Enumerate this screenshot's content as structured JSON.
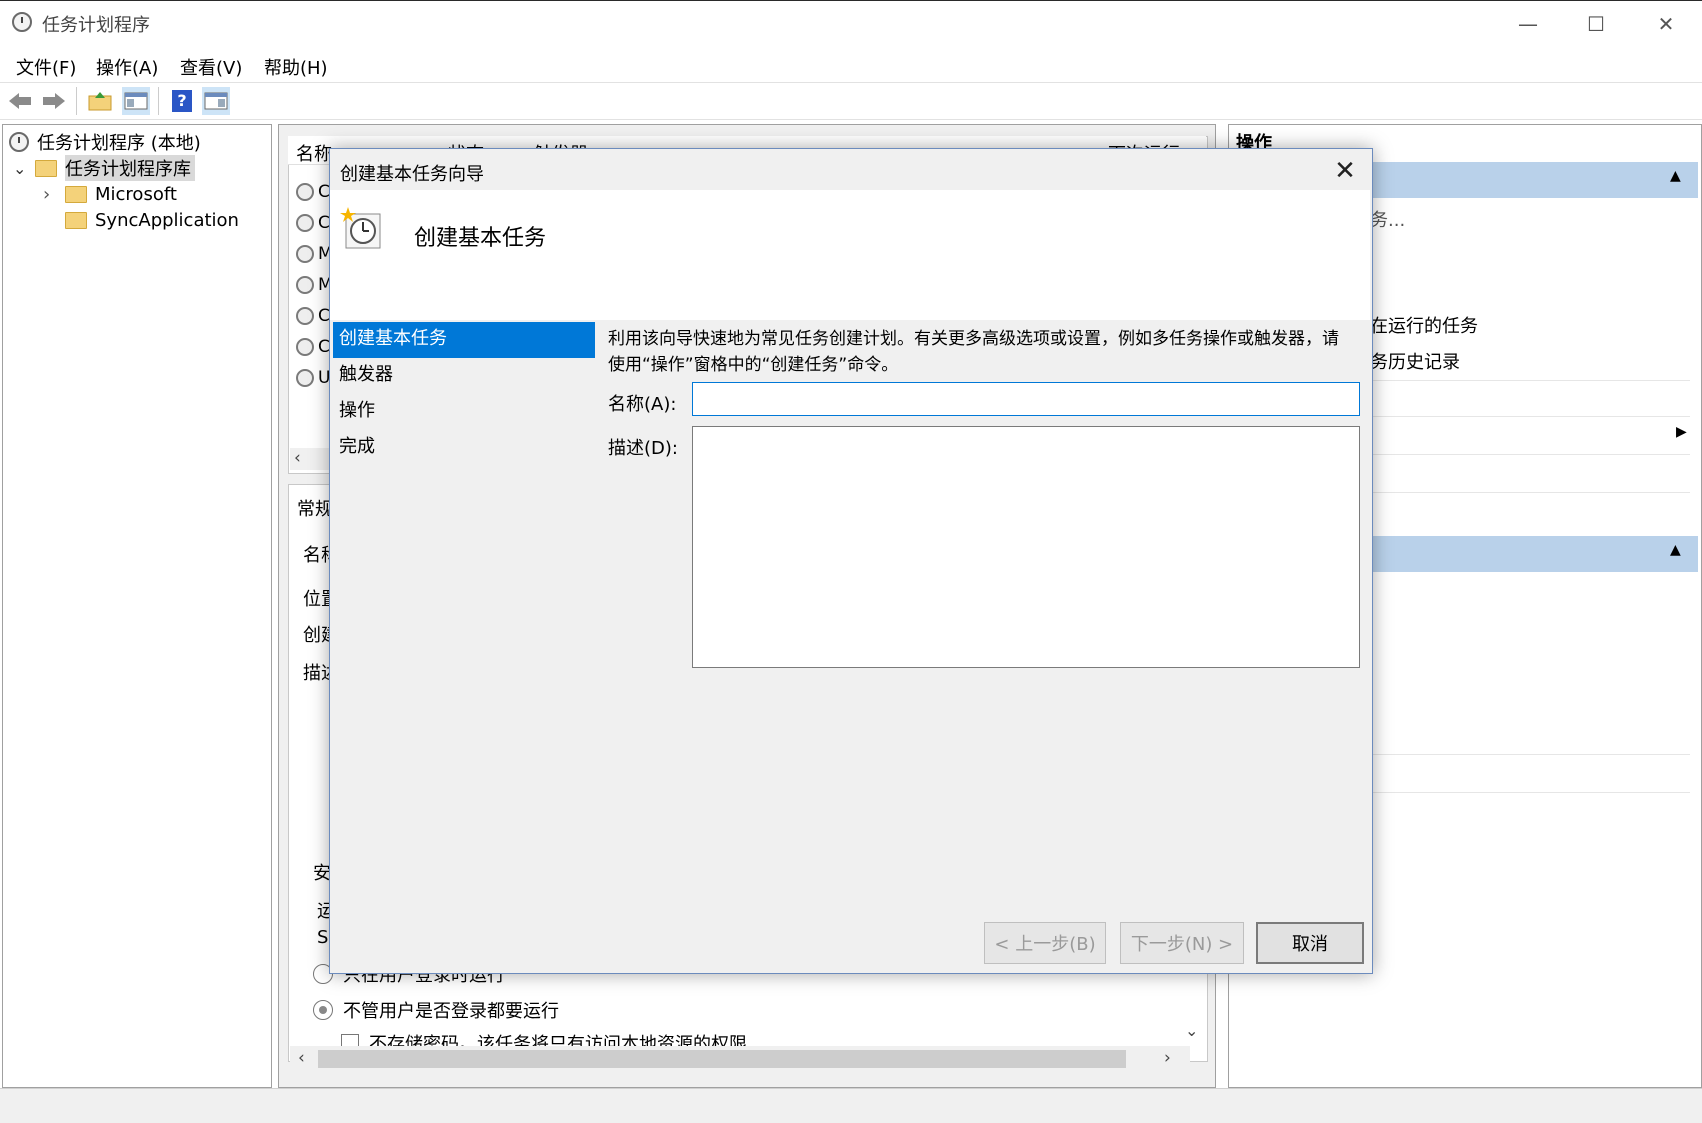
{
  "window": {
    "title": "任务计划程序",
    "min_glyph": "—",
    "max_glyph": "☐",
    "close_glyph": "✕"
  },
  "menu": [
    "文件(F)",
    "操作(A)",
    "查看(V)",
    "帮助(H)"
  ],
  "toolbar": {
    "back_icon": "back-arrow-icon",
    "forward_icon": "forward-arrow-icon",
    "help_glyph": "?"
  },
  "tree": {
    "root": "任务计划程序 (本地)",
    "library": "任务计划程序库",
    "expand_glyph": "⌄",
    "collapse_glyph": "›",
    "children": [
      "Microsoft",
      "SyncApplication"
    ]
  },
  "task_list": {
    "headers": [
      "名称",
      "状态",
      "触发器",
      "下次运行"
    ],
    "rows_initials": [
      "C",
      "C",
      "M",
      "M",
      "C",
      "C",
      "U"
    ],
    "scroll_left": "‹"
  },
  "details": {
    "tab_general": "常规",
    "field_labels": [
      "名称",
      "位置",
      "创建",
      "描述"
    ],
    "security_label": "安",
    "run_as_label": "运",
    "run_as_value": "S",
    "radio_logged_on": "只在用户登录时运行",
    "radio_always": "不管用户是否登录都要运行",
    "checkbox_no_password": "不存储密码。该任务将只有访问本地资源的权限",
    "scroll_down": "⌄",
    "scroll_left": "‹",
    "scroll_right": "›"
  },
  "actions": {
    "header": "操作",
    "item1": "务...",
    "item2": "在运行的任务",
    "item3": "务历史记录",
    "collapse_glyph": "▲",
    "submenu_glyph": "▶"
  },
  "dialog": {
    "title": "创建基本任务向导",
    "close_glyph": "✕",
    "heading": "创建基本任务",
    "steps": [
      "创建基本任务",
      "触发器",
      "操作",
      "完成"
    ],
    "intro": "利用该向导快速地为常见任务创建计划。有关更多高级选项或设置，例如多任务操作或触发器，请使用“操作”窗格中的“创建任务”命令。",
    "name_label": "名称(A):",
    "name_value": "",
    "desc_label": "描述(D):",
    "desc_value": "",
    "back_button": "< 上一步(B)",
    "next_button": "下一步(N) >",
    "cancel_button": "取消"
  }
}
